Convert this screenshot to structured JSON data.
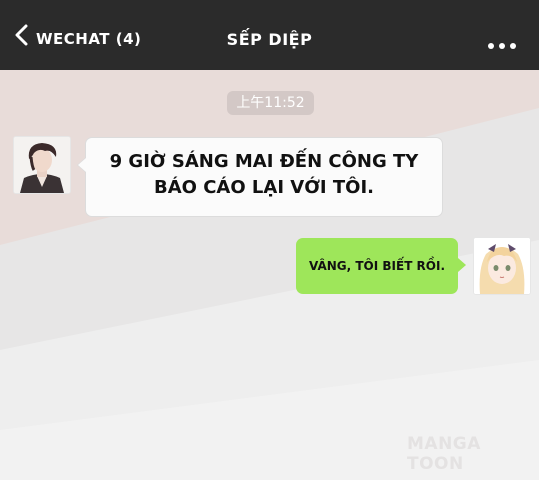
{
  "header": {
    "back_label": "WECHAT (4)",
    "title": "SẾP DIỆP",
    "back_icon": "chevron-left-icon",
    "more_icon": "more-dots-icon"
  },
  "chat": {
    "timestamp": "上午11:52",
    "messages": [
      {
        "side": "left",
        "lines": [
          "9 GIỜ SÁNG MAI ĐẾN CÔNG TY",
          "BÁO CÁO LẠI VỚI TÔI."
        ]
      },
      {
        "side": "right",
        "text": "VÂNG, TÔI BIẾT RỒI."
      }
    ]
  },
  "watermark": "MANGA TOON",
  "colors": {
    "topbar": "#2b2b2b",
    "bubble_right": "#9ee65a",
    "bubble_left": "#fbfbfb"
  }
}
